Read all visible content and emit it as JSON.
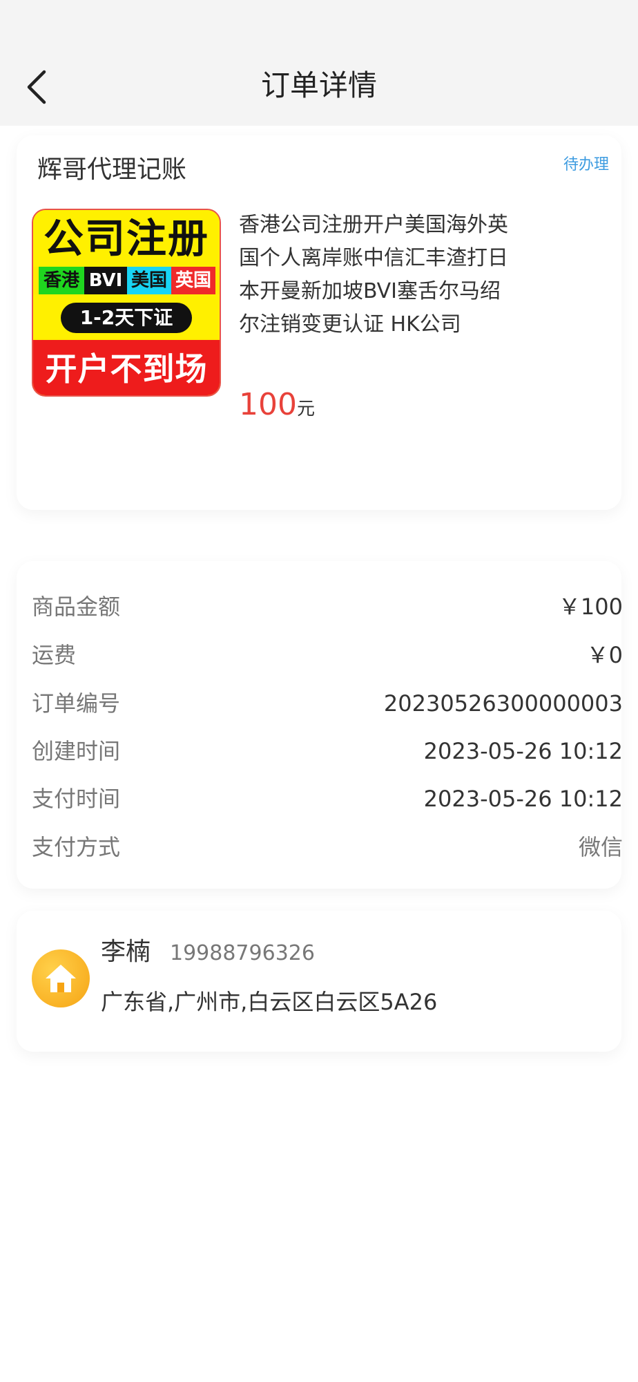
{
  "header": {
    "title": "订单详情",
    "back_icon": "chevron-left-icon"
  },
  "order": {
    "store_name": "辉哥代理记账",
    "status": "待办理",
    "status_color": "#3c9be0",
    "product": {
      "title": "香港公司注册开户美国海外英国个人离岸账中信汇丰渣打日本开曼新加坡BVI塞舌尔马绍尔注销变更认证 HK公司",
      "price": "100",
      "price_unit": "元",
      "price_color": "#e8423a",
      "image": {
        "headline": "公司注册",
        "tags": [
          "香港",
          "BVI",
          "美国",
          "英国"
        ],
        "pill": "1-2天下证",
        "bottom": "开户不到场"
      }
    }
  },
  "details": [
    {
      "label": "商品金额",
      "value": "￥100"
    },
    {
      "label": "运费",
      "value": "￥0"
    },
    {
      "label": "订单编号",
      "value": "20230526300000003"
    },
    {
      "label": "创建时间",
      "value": "2023-05-26 10:12"
    },
    {
      "label": "支付时间",
      "value": "2023-05-26 10:12"
    },
    {
      "label": "支付方式",
      "value": "微信"
    }
  ],
  "contact": {
    "icon": "home-icon",
    "name": "李楠",
    "phone": "19988796326",
    "address": "广东省,广州市,白云区白云区5A26"
  }
}
